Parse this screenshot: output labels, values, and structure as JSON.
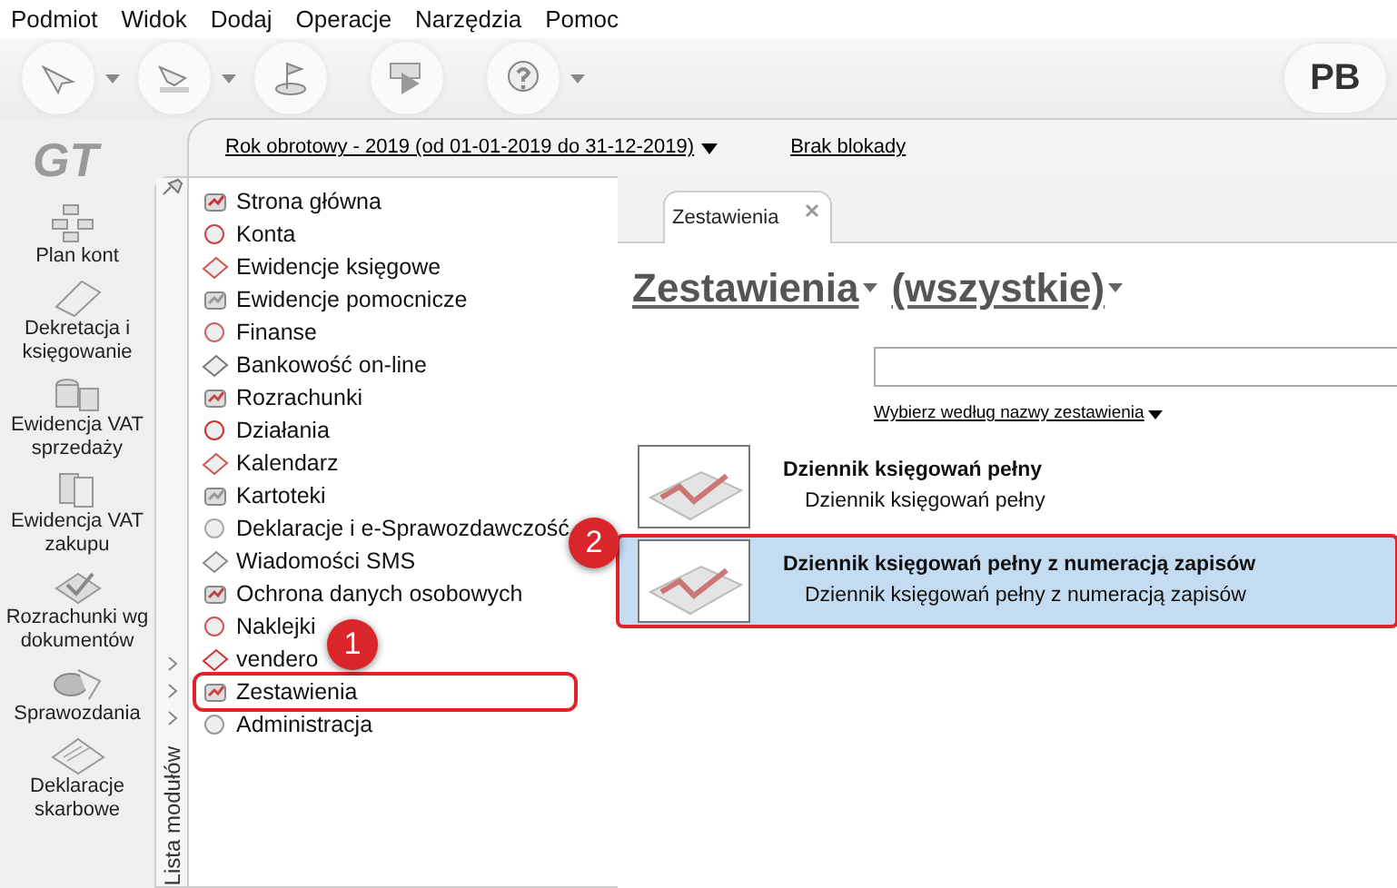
{
  "menu": [
    "Podmiot",
    "Widok",
    "Dodaj",
    "Operacje",
    "Narzędzia",
    "Pomoc"
  ],
  "toolbar": [
    {
      "has_menu": true
    },
    {
      "has_menu": true
    },
    {
      "has_menu": false
    },
    {
      "has_menu": false
    },
    {
      "has_menu": true
    }
  ],
  "user_initials": "PB",
  "logo": "GT",
  "sidebar": [
    "Plan kont",
    "Dekretacja i księgowanie",
    "Ewidencja VAT sprzedaży",
    "Ewidencja VAT zakupu",
    "Rozrachunki wg dokumentów",
    "Sprawozdania",
    "Deklaracje skarbowe"
  ],
  "period_link": "Rok obrotowy - 2019  (od 01-01-2019 do 31-12-2019)",
  "lock_link": "Brak blokady",
  "module_panel_title": "Lista modułów",
  "modules": [
    {
      "label": "Strona główna",
      "highlighted": false
    },
    {
      "label": "Konta",
      "highlighted": false
    },
    {
      "label": "Ewidencje księgowe",
      "highlighted": false
    },
    {
      "label": "Ewidencje pomocnicze",
      "highlighted": false
    },
    {
      "label": "Finanse",
      "highlighted": false
    },
    {
      "label": "Bankowość on-line",
      "highlighted": false
    },
    {
      "label": "Rozrachunki",
      "highlighted": false
    },
    {
      "label": "Działania",
      "highlighted": false
    },
    {
      "label": "Kalendarz",
      "highlighted": false
    },
    {
      "label": "Kartoteki",
      "highlighted": false
    },
    {
      "label": "Deklaracje i e-Sprawozdawczość",
      "highlighted": false
    },
    {
      "label": "Wiadomości SMS",
      "highlighted": false
    },
    {
      "label": "Ochrona danych osobowych",
      "highlighted": false
    },
    {
      "label": "Naklejki",
      "highlighted": false
    },
    {
      "label": "vendero",
      "highlighted": false
    },
    {
      "label": "Zestawienia",
      "highlighted": true
    },
    {
      "label": "Administracja",
      "highlighted": false
    }
  ],
  "tabs": [
    {
      "label": "Zestawienia",
      "selected": true
    }
  ],
  "heading": {
    "category": "Zestawienia",
    "filter": "(wszystkie)"
  },
  "sort_link": "Wybierz według nazwy zestawienia",
  "reports": [
    {
      "title": "Dziennik księgowań pełny",
      "description": "Dziennik księgowań pełny",
      "selected": false,
      "highlighted": false
    },
    {
      "title": "Dziennik księgowań pełny z numeracją zapisów",
      "description": "Dziennik księgowań pełny z numeracją zapisów",
      "selected": true,
      "highlighted": true
    }
  ],
  "annotations": [
    {
      "label": "1"
    },
    {
      "label": "2"
    }
  ]
}
